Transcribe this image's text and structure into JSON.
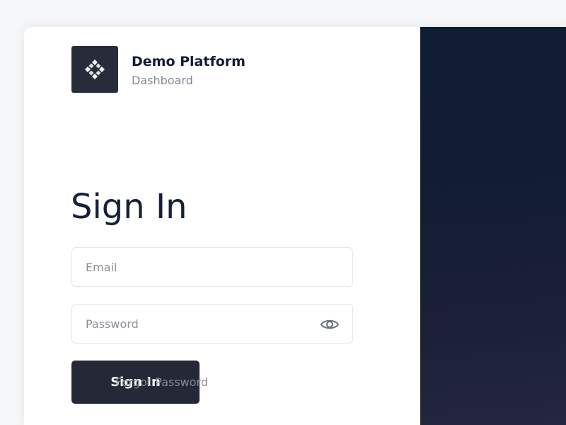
{
  "brand": {
    "name": "Demo Platform",
    "subtitle": "Dashboard",
    "logo_icon": "diamond-grid-icon"
  },
  "form": {
    "title": "Sign In",
    "email": {
      "value": "",
      "placeholder": "Email"
    },
    "password": {
      "value": "",
      "placeholder": "Password",
      "toggle_icon": "eye-icon"
    },
    "submit_label": "Sign In",
    "forgot_label": "Forgot Password"
  },
  "colors": {
    "primary": "#252836",
    "heading": "#142136",
    "muted": "#848b96",
    "side_panel": "#131d34"
  }
}
